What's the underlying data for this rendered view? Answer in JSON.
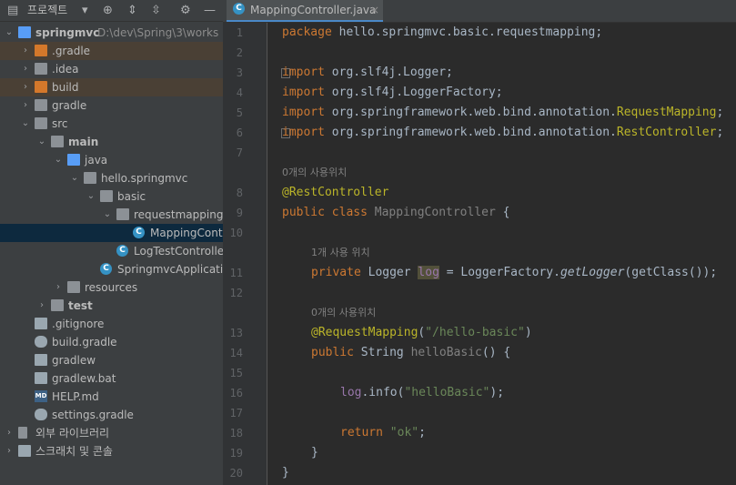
{
  "project_panel": {
    "title": "프로젝트",
    "tree": [
      {
        "label": "springmvc",
        "path": " D:\\dev\\Spring\\3\\works",
        "depth": 0,
        "arrow": "down",
        "icon": "module-folder"
      },
      {
        "label": ".gradle",
        "depth": 1,
        "arrow": "right",
        "icon": "folder-orange",
        "highlight": true
      },
      {
        "label": ".idea",
        "depth": 1,
        "arrow": "right",
        "icon": "folder-grey"
      },
      {
        "label": "build",
        "depth": 1,
        "arrow": "right",
        "icon": "folder-orange",
        "highlight": true
      },
      {
        "label": "gradle",
        "depth": 1,
        "arrow": "right",
        "icon": "folder-grey"
      },
      {
        "label": "src",
        "depth": 1,
        "arrow": "down",
        "icon": "folder-grey"
      },
      {
        "label": "main",
        "depth": 2,
        "arrow": "down",
        "icon": "folder-grey"
      },
      {
        "label": "java",
        "depth": 3,
        "arrow": "down",
        "icon": "folder-blue"
      },
      {
        "label": "hello.springmvc",
        "depth": 4,
        "arrow": "down",
        "icon": "package"
      },
      {
        "label": "basic",
        "depth": 5,
        "arrow": "down",
        "icon": "package"
      },
      {
        "label": "requestmapping",
        "depth": 6,
        "arrow": "down",
        "icon": "package"
      },
      {
        "label": "MappingContro",
        "depth": 7,
        "arrow": "",
        "icon": "class",
        "selected": true
      },
      {
        "label": "LogTestController",
        "depth": 6,
        "arrow": "",
        "icon": "class"
      },
      {
        "label": "SpringmvcApplication",
        "depth": 5,
        "arrow": "",
        "icon": "class"
      },
      {
        "label": "resources",
        "depth": 3,
        "arrow": "right",
        "icon": "folder-grey"
      },
      {
        "label": "test",
        "depth": 2,
        "arrow": "right",
        "icon": "folder-grey"
      },
      {
        "label": ".gitignore",
        "depth": 1,
        "arrow": "",
        "icon": "file"
      },
      {
        "label": "build.gradle",
        "depth": 1,
        "arrow": "",
        "icon": "gradle"
      },
      {
        "label": "gradlew",
        "depth": 1,
        "arrow": "",
        "icon": "file"
      },
      {
        "label": "gradlew.bat",
        "depth": 1,
        "arrow": "",
        "icon": "file"
      },
      {
        "label": "HELP.md",
        "depth": 1,
        "arrow": "",
        "icon": "md"
      },
      {
        "label": "settings.gradle",
        "depth": 1,
        "arrow": "",
        "icon": "gradle"
      },
      {
        "label": "외부 라이브러리",
        "depth": 0,
        "arrow": "right",
        "icon": "libraries"
      },
      {
        "label": "스크래치 및 콘솔",
        "depth": 0,
        "arrow": "right",
        "icon": "scratches"
      }
    ]
  },
  "editor": {
    "tab_label": "MappingController.java",
    "tab_close": "×",
    "hints": {
      "h1": "0개의 사용위치",
      "h2": "1개 사용 위치",
      "h3": "0개의 사용위치"
    },
    "lines": {
      "l1_kw": "package",
      "l1_rest": " hello.springmvc.basic.requestmapping;",
      "l3_kw": "import",
      "l3_rest": " org.slf4j.Logger;",
      "l4_kw": "import",
      "l4_rest": " org.slf4j.LoggerFactory;",
      "l5_kw": "import",
      "l5_rest": " org.springframework.web.bind.annotation.",
      "l5_ann": "RequestMapping",
      "l5_end": ";",
      "l6_kw": "import",
      "l6_rest": " org.springframework.web.bind.annotation.",
      "l6_ann": "RestController",
      "l6_end": ";",
      "l8_ann": "@RestController",
      "l9_kw": "public class",
      "l9_cls": " MappingController",
      "l9_rest": " {",
      "l11_kw": "private",
      "l11_a": " Logger ",
      "l11_var": "log",
      "l11_b": " = LoggerFactory.",
      "l11_m": "getLogger",
      "l11_c": "(getClass());",
      "l13_ann": "@RequestMapping",
      "l13_a": "(",
      "l13_str": "\"/hello-basic\"",
      "l13_b": ")",
      "l14_kw": "public",
      "l14_a": " String ",
      "l14_m": "helloBasic",
      "l14_b": "() {",
      "l16_fld": "log",
      "l16_a": ".info(",
      "l16_str": "\"helloBasic\"",
      "l16_b": ");",
      "l18_kw": "return",
      "l18_str": " \"ok\"",
      "l18_b": ";",
      "l19": "}",
      "l20": "}"
    },
    "line_numbers": [
      "1",
      "2",
      "3",
      "4",
      "5",
      "6",
      "7",
      "8",
      "9",
      "10",
      "11",
      "12",
      "13",
      "14",
      "15",
      "16",
      "17",
      "18",
      "19",
      "20"
    ]
  },
  "colors": {
    "keyword": "#cc7832",
    "annotation": "#bbb529",
    "string": "#6a8759",
    "field": "#9876aa",
    "text": "#a9b7c6"
  }
}
